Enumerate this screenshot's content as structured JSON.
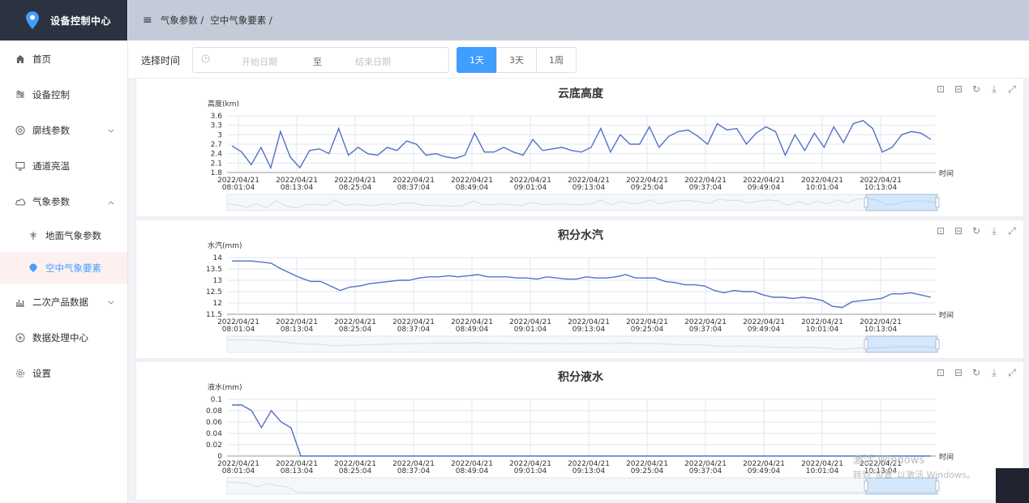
{
  "app": {
    "title": "设备控制中心"
  },
  "sidebar": {
    "items": [
      {
        "label": "首页",
        "icon": "home-icon"
      },
      {
        "label": "设备控制",
        "icon": "sliders-icon"
      },
      {
        "label": "廓线参数",
        "icon": "circle-icon"
      },
      {
        "label": "通道亮温",
        "icon": "monitor-icon"
      },
      {
        "label": "气象参数",
        "icon": "cloud-icon"
      },
      {
        "label": "地面气象参数",
        "icon": "weathervane-icon"
      },
      {
        "label": "空中气象要素",
        "icon": "balloon-icon"
      },
      {
        "label": "二次产品数据",
        "icon": "bar-chart-icon"
      },
      {
        "label": "数据处理中心",
        "icon": "database-icon"
      },
      {
        "label": "设置",
        "icon": "gear-icon"
      }
    ]
  },
  "breadcrumb": {
    "item1": "气象参数 /",
    "item2": "空中气象要素 /"
  },
  "toolbar": {
    "time_label": "选择时间",
    "start_placeholder": "开始日期",
    "separator": "至",
    "end_placeholder": "结束日期",
    "ranges": [
      "1天",
      "3天",
      "1周"
    ],
    "selected_range": "1天"
  },
  "colors": {
    "accent": "#409eff",
    "series": "#5470c6",
    "topbar": "#c3cbd9",
    "logo_bg": "#2b3340"
  },
  "watermark": {
    "line1": "激活 Windows",
    "line2": "转到\"设置\"以激活 Windows。"
  },
  "chart_data": [
    {
      "type": "line",
      "title": "云底高度",
      "ylabel": "高度(km)",
      "xlabel": "时间",
      "ylim": [
        1.8,
        3.6
      ],
      "yticks": [
        "3.6",
        "3.3",
        "3",
        "2.7",
        "2.4",
        "2.1",
        "1.8"
      ],
      "xticks": [
        [
          "2022/04/21",
          "08:01:04"
        ],
        [
          "2022/04/21",
          "08:13:04"
        ],
        [
          "2022/04/21",
          "08:25:04"
        ],
        [
          "2022/04/21",
          "08:37:04"
        ],
        [
          "2022/04/21",
          "08:49:04"
        ],
        [
          "2022/04/21",
          "09:01:04"
        ],
        [
          "2022/04/21",
          "09:13:04"
        ],
        [
          "2022/04/21",
          "09:25:04"
        ],
        [
          "2022/04/21",
          "09:37:04"
        ],
        [
          "2022/04/21",
          "09:49:04"
        ],
        [
          "2022/04/21",
          "10:01:04"
        ],
        [
          "2022/04/21",
          "10:13:04"
        ]
      ],
      "values": [
        2.65,
        2.45,
        2.05,
        2.6,
        1.95,
        3.1,
        2.3,
        1.95,
        2.5,
        2.55,
        2.4,
        3.2,
        2.35,
        2.6,
        2.4,
        2.35,
        2.6,
        2.5,
        2.8,
        2.7,
        2.35,
        2.4,
        2.3,
        2.25,
        2.35,
        3.05,
        2.45,
        2.45,
        2.6,
        2.45,
        2.35,
        2.85,
        2.5,
        2.55,
        2.6,
        2.5,
        2.45,
        2.6,
        3.2,
        2.45,
        3.0,
        2.7,
        2.7,
        3.25,
        2.6,
        2.95,
        3.1,
        3.15,
        2.95,
        2.7,
        3.35,
        3.15,
        3.2,
        2.7,
        3.05,
        3.25,
        3.1,
        2.35,
        3.0,
        2.5,
        3.05,
        2.6,
        3.25,
        2.75,
        3.35,
        3.45,
        3.2,
        2.45,
        2.6,
        3.0,
        3.1,
        3.05,
        2.85
      ]
    },
    {
      "type": "line",
      "title": "积分水汽",
      "ylabel": "水汽(mm)",
      "xlabel": "时间",
      "ylim": [
        11.5,
        14
      ],
      "yticks": [
        "14",
        "13.5",
        "13",
        "12.5",
        "12",
        "11.5"
      ],
      "xticks": [
        [
          "2022/04/21",
          "08:01:04"
        ],
        [
          "2022/04/21",
          "08:13:04"
        ],
        [
          "2022/04/21",
          "08:25:04"
        ],
        [
          "2022/04/21",
          "08:37:04"
        ],
        [
          "2022/04/21",
          "08:49:04"
        ],
        [
          "2022/04/21",
          "09:01:04"
        ],
        [
          "2022/04/21",
          "09:13:04"
        ],
        [
          "2022/04/21",
          "09:25:04"
        ],
        [
          "2022/04/21",
          "09:37:04"
        ],
        [
          "2022/04/21",
          "09:49:04"
        ],
        [
          "2022/04/21",
          "10:01:04"
        ],
        [
          "2022/04/21",
          "10:13:04"
        ]
      ],
      "values": [
        13.85,
        13.85,
        13.85,
        13.8,
        13.75,
        13.5,
        13.3,
        13.1,
        12.95,
        12.95,
        12.75,
        12.55,
        12.7,
        12.75,
        12.85,
        12.9,
        12.95,
        13.0,
        13.0,
        13.1,
        13.15,
        13.15,
        13.2,
        13.15,
        13.2,
        13.25,
        13.15,
        13.15,
        13.15,
        13.1,
        13.1,
        13.05,
        13.15,
        13.1,
        13.05,
        13.05,
        13.15,
        13.1,
        13.1,
        13.15,
        13.25,
        13.1,
        13.1,
        13.1,
        12.95,
        12.9,
        12.8,
        12.8,
        12.75,
        12.55,
        12.45,
        12.55,
        12.5,
        12.5,
        12.35,
        12.25,
        12.25,
        12.2,
        12.25,
        12.2,
        12.1,
        11.85,
        11.8,
        12.05,
        12.1,
        12.15,
        12.2,
        12.4,
        12.4,
        12.45,
        12.35,
        12.25
      ]
    },
    {
      "type": "line",
      "title": "积分液水",
      "ylabel": "液水(mm)",
      "xlabel": "时间",
      "ylim": [
        0,
        0.1
      ],
      "yticks": [
        "0.1",
        "0.08",
        "0.06",
        "0.04",
        "0.02",
        "0"
      ],
      "xticks": [
        [
          "2022/04/21",
          "08:01:04"
        ],
        [
          "2022/04/21",
          "08:13:04"
        ],
        [
          "2022/04/21",
          "08:25:04"
        ],
        [
          "2022/04/21",
          "08:37:04"
        ],
        [
          "2022/04/21",
          "08:49:04"
        ],
        [
          "2022/04/21",
          "09:01:04"
        ],
        [
          "2022/04/21",
          "09:13:04"
        ],
        [
          "2022/04/21",
          "09:25:04"
        ],
        [
          "2022/04/21",
          "09:37:04"
        ],
        [
          "2022/04/21",
          "09:49:04"
        ],
        [
          "2022/04/21",
          "10:01:04"
        ],
        [
          "2022/04/21",
          "10:13:04"
        ]
      ],
      "values": [
        0.09,
        0.09,
        0.08,
        0.05,
        0.08,
        0.06,
        0.05,
        0.0,
        0,
        0,
        0,
        0,
        0,
        0,
        0,
        0,
        0,
        0,
        0,
        0,
        0,
        0,
        0,
        0,
        0,
        0,
        0,
        0,
        0,
        0,
        0,
        0,
        0,
        0,
        0,
        0,
        0,
        0,
        0,
        0,
        0,
        0,
        0,
        0,
        0,
        0,
        0,
        0,
        0,
        0,
        0,
        0,
        0,
        0,
        0,
        0,
        0,
        0,
        0,
        0,
        0,
        0,
        0,
        0,
        0,
        0,
        0,
        0,
        0,
        0,
        0,
        0
      ]
    }
  ]
}
